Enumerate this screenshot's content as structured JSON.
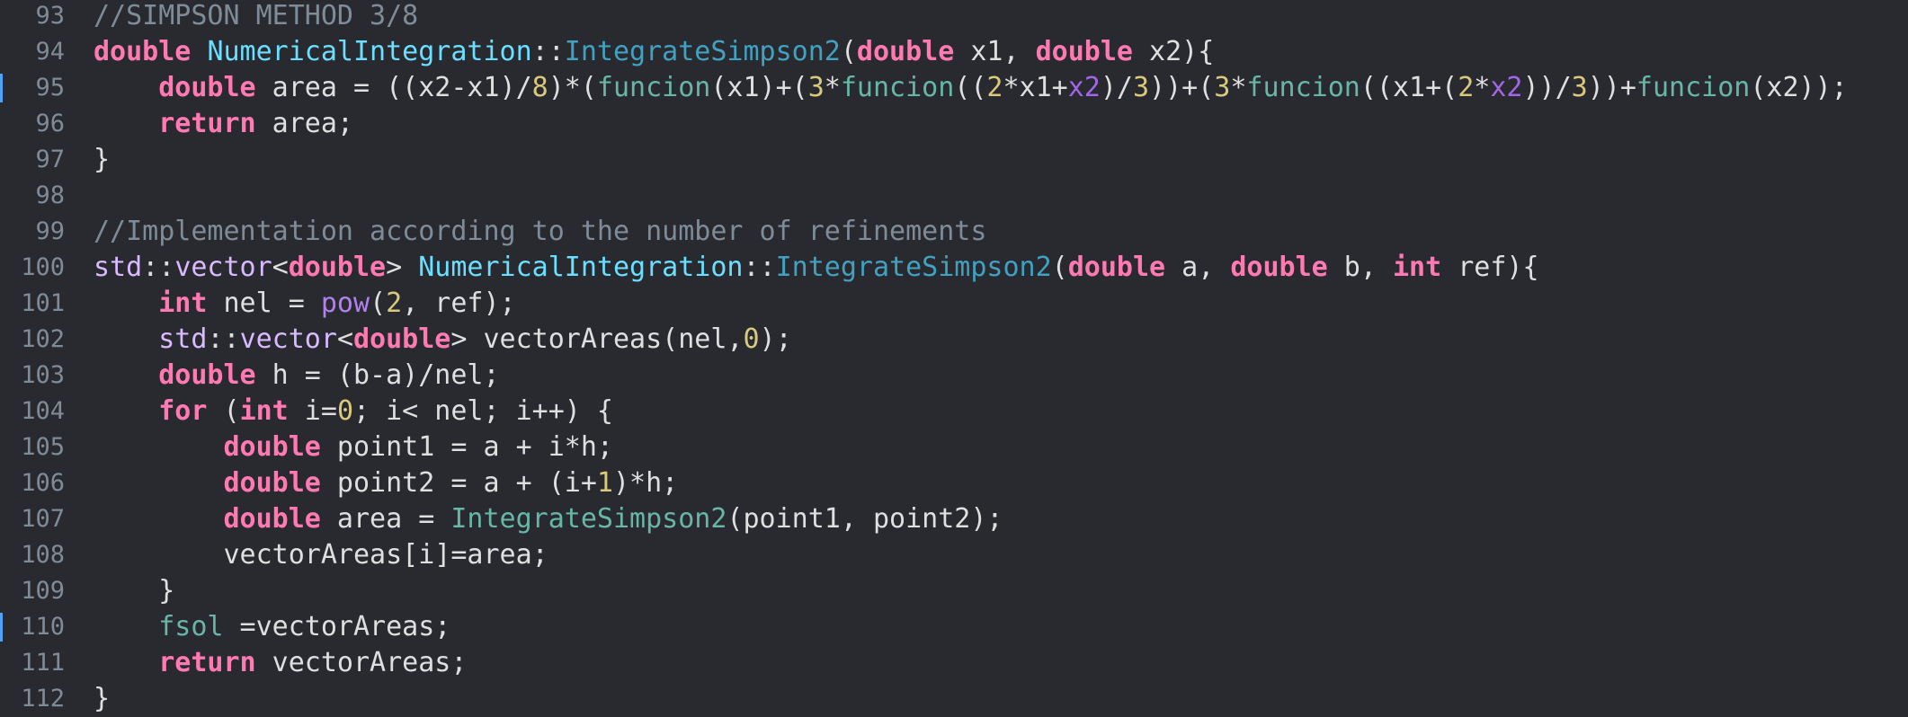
{
  "colors": {
    "background": "#292a30",
    "plain": "#dfdfe0",
    "comment": "#7f8c98",
    "keyword": "#ff7ab2",
    "number": "#d9c97c",
    "function": "#67b7a4",
    "declaration": "#41a1c0",
    "change_marker": "#4fa3f7"
  },
  "lines": [
    {
      "num": "93",
      "changed": false,
      "tokens": [
        [
          "comment",
          "//SIMPSON METHOD 3/8"
        ]
      ]
    },
    {
      "num": "94",
      "changed": false,
      "tokens": [
        [
          "keyword",
          "double"
        ],
        [
          "plain",
          " "
        ],
        [
          "type-decl",
          "NumericalIntegration"
        ],
        [
          "plain",
          "::"
        ],
        [
          "func-decl",
          "IntegrateSimpson2"
        ],
        [
          "plain",
          "("
        ],
        [
          "keyword",
          "double"
        ],
        [
          "plain",
          " x1, "
        ],
        [
          "keyword",
          "double"
        ],
        [
          "plain",
          " x2){"
        ]
      ]
    },
    {
      "num": "95",
      "changed": true,
      "tokens": [
        [
          "plain",
          "    "
        ],
        [
          "keyword",
          "double"
        ],
        [
          "plain",
          " area = ((x2-x1)/"
        ],
        [
          "number",
          "8"
        ],
        [
          "plain",
          ")*("
        ],
        [
          "func",
          "funcion"
        ],
        [
          "plain",
          "(x1)+("
        ],
        [
          "number",
          "3"
        ],
        [
          "plain",
          "*"
        ],
        [
          "func",
          "funcion"
        ],
        [
          "plain",
          "(("
        ],
        [
          "number",
          "2"
        ],
        [
          "plain",
          "*x1+"
        ],
        [
          "param",
          "x2"
        ],
        [
          "plain",
          ")/"
        ],
        [
          "number",
          "3"
        ],
        [
          "plain",
          "))+("
        ],
        [
          "number",
          "3"
        ],
        [
          "plain",
          "*"
        ],
        [
          "func",
          "funcion"
        ],
        [
          "plain",
          "((x1+("
        ],
        [
          "number",
          "2"
        ],
        [
          "plain",
          "*"
        ],
        [
          "param",
          "x2"
        ],
        [
          "plain",
          "))/"
        ],
        [
          "number",
          "3"
        ],
        [
          "plain",
          "))+"
        ],
        [
          "func",
          "funcion"
        ],
        [
          "plain",
          "(x2));"
        ]
      ]
    },
    {
      "num": "96",
      "changed": false,
      "tokens": [
        [
          "plain",
          "    "
        ],
        [
          "keyword",
          "return"
        ],
        [
          "plain",
          " area;"
        ]
      ]
    },
    {
      "num": "97",
      "changed": false,
      "tokens": [
        [
          "plain",
          "}"
        ]
      ]
    },
    {
      "num": "98",
      "changed": false,
      "tokens": []
    },
    {
      "num": "99",
      "changed": false,
      "tokens": [
        [
          "comment",
          "//Implementation according to the number of refinements"
        ]
      ]
    },
    {
      "num": "100",
      "changed": false,
      "tokens": [
        [
          "std",
          "std"
        ],
        [
          "plain",
          "::"
        ],
        [
          "std",
          "vector"
        ],
        [
          "plain",
          "<"
        ],
        [
          "keyword",
          "double"
        ],
        [
          "plain",
          "> "
        ],
        [
          "type-decl",
          "NumericalIntegration"
        ],
        [
          "plain",
          "::"
        ],
        [
          "func-decl",
          "IntegrateSimpson2"
        ],
        [
          "plain",
          "("
        ],
        [
          "keyword",
          "double"
        ],
        [
          "plain",
          " a, "
        ],
        [
          "keyword",
          "double"
        ],
        [
          "plain",
          " b, "
        ],
        [
          "keyword",
          "int"
        ],
        [
          "plain",
          " ref){"
        ]
      ]
    },
    {
      "num": "101",
      "changed": false,
      "tokens": [
        [
          "plain",
          "    "
        ],
        [
          "keyword",
          "int"
        ],
        [
          "plain",
          " nel = "
        ],
        [
          "builtin",
          "pow"
        ],
        [
          "plain",
          "("
        ],
        [
          "number",
          "2"
        ],
        [
          "plain",
          ", ref);"
        ]
      ]
    },
    {
      "num": "102",
      "changed": false,
      "tokens": [
        [
          "plain",
          "    "
        ],
        [
          "std",
          "std"
        ],
        [
          "plain",
          "::"
        ],
        [
          "std",
          "vector"
        ],
        [
          "plain",
          "<"
        ],
        [
          "keyword",
          "double"
        ],
        [
          "plain",
          "> vectorAreas(nel,"
        ],
        [
          "number",
          "0"
        ],
        [
          "plain",
          ");"
        ]
      ]
    },
    {
      "num": "103",
      "changed": false,
      "tokens": [
        [
          "plain",
          "    "
        ],
        [
          "keyword",
          "double"
        ],
        [
          "plain",
          " h = (b-a)/nel;"
        ]
      ]
    },
    {
      "num": "104",
      "changed": false,
      "tokens": [
        [
          "plain",
          "    "
        ],
        [
          "keyword",
          "for"
        ],
        [
          "plain",
          " ("
        ],
        [
          "keyword",
          "int"
        ],
        [
          "plain",
          " i="
        ],
        [
          "number",
          "0"
        ],
        [
          "plain",
          "; i< nel; i++) {"
        ]
      ]
    },
    {
      "num": "105",
      "changed": false,
      "tokens": [
        [
          "plain",
          "        "
        ],
        [
          "keyword",
          "double"
        ],
        [
          "plain",
          " point1 = a + i*h;"
        ]
      ]
    },
    {
      "num": "106",
      "changed": false,
      "tokens": [
        [
          "plain",
          "        "
        ],
        [
          "keyword",
          "double"
        ],
        [
          "plain",
          " point2 = a + (i+"
        ],
        [
          "number",
          "1"
        ],
        [
          "plain",
          ")*h;"
        ]
      ]
    },
    {
      "num": "107",
      "changed": false,
      "tokens": [
        [
          "plain",
          "        "
        ],
        [
          "keyword",
          "double"
        ],
        [
          "plain",
          " area = "
        ],
        [
          "func",
          "IntegrateSimpson2"
        ],
        [
          "plain",
          "(point1, point2);"
        ]
      ]
    },
    {
      "num": "108",
      "changed": false,
      "tokens": [
        [
          "plain",
          "        vectorAreas[i]=area;"
        ]
      ]
    },
    {
      "num": "109",
      "changed": false,
      "tokens": [
        [
          "plain",
          "    }"
        ]
      ]
    },
    {
      "num": "110",
      "changed": true,
      "tokens": [
        [
          "plain",
          "    "
        ],
        [
          "member",
          "fsol"
        ],
        [
          "plain",
          " =vectorAreas;"
        ]
      ]
    },
    {
      "num": "111",
      "changed": false,
      "tokens": [
        [
          "plain",
          "    "
        ],
        [
          "keyword",
          "return"
        ],
        [
          "plain",
          " vectorAreas;"
        ]
      ]
    },
    {
      "num": "112",
      "changed": false,
      "tokens": [
        [
          "plain",
          "}"
        ]
      ]
    }
  ]
}
